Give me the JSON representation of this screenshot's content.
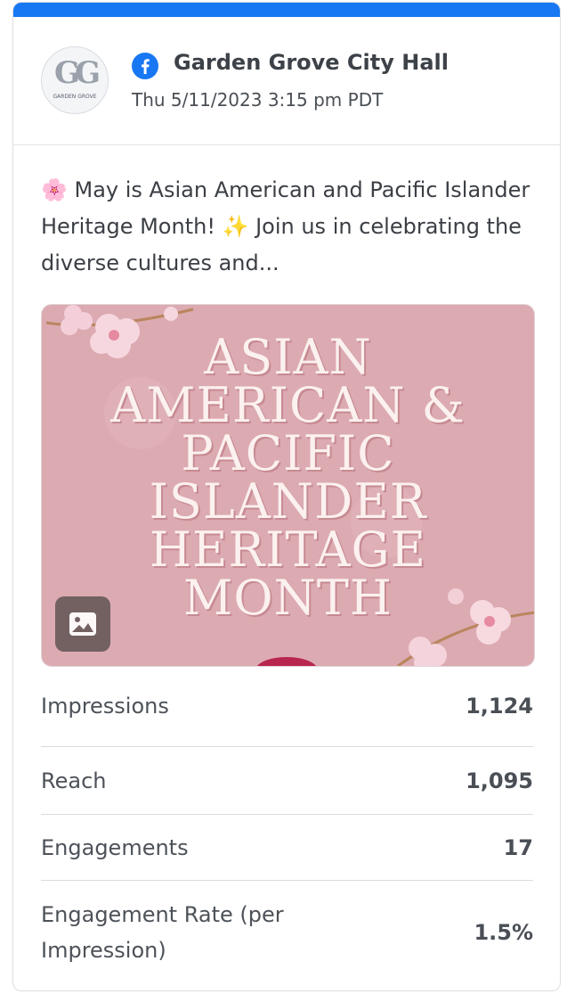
{
  "post": {
    "account_name": "Garden Grove City Hall",
    "timestamp": "Thu 5/11/2023 3:15 pm PDT",
    "platform_icon": "facebook-icon",
    "avatar_text": "G",
    "avatar_subtext": "GARDEN GROVE",
    "body_text": "🌸 May is Asian American and Pacific Islander Heritage Month! ✨ Join us in celebrating the diverse cultures and...",
    "image": {
      "lines": [
        "ASIAN",
        "AMERICAN &",
        "PACIFIC",
        "ISLANDER",
        "HERITAGE",
        "MONTH"
      ],
      "badge_icon": "image-icon"
    }
  },
  "stats": [
    {
      "label": "Impressions",
      "value": "1,124"
    },
    {
      "label": "Reach",
      "value": "1,095"
    },
    {
      "label": "Engagements",
      "value": "17"
    },
    {
      "label": "Engagement Rate (per Impression)",
      "value": "1.5%"
    }
  ],
  "colors": {
    "accent": "#1877f2",
    "image_bg": "#dcaab1"
  }
}
